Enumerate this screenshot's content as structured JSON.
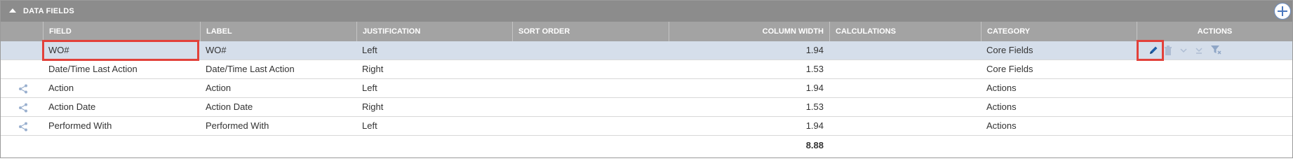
{
  "panel": {
    "title": "DATA FIELDS"
  },
  "columns": {
    "field": "FIELD",
    "label": "LABEL",
    "justification": "JUSTIFICATION",
    "sort_order": "SORT ORDER",
    "column_width": "COLUMN WIDTH",
    "calculations": "CALCULATIONS",
    "category": "CATEGORY",
    "actions": "ACTIONS"
  },
  "rows": [
    {
      "field": "WO#",
      "label": "WO#",
      "justification": "Left",
      "sort_order": "",
      "column_width": "1.94",
      "calculations": "",
      "category": "Core Fields"
    },
    {
      "field": "Date/Time Last Action",
      "label": "Date/Time Last Action",
      "justification": "Right",
      "sort_order": "",
      "column_width": "1.53",
      "calculations": "",
      "category": "Core Fields"
    },
    {
      "field": "Action",
      "label": "Action",
      "justification": "Left",
      "sort_order": "",
      "column_width": "1.94",
      "calculations": "",
      "category": "Actions"
    },
    {
      "field": "Action Date",
      "label": "Action Date",
      "justification": "Right",
      "sort_order": "",
      "column_width": "1.53",
      "calculations": "",
      "category": "Actions"
    },
    {
      "field": "Performed With",
      "label": "Performed With",
      "justification": "Left",
      "sort_order": "",
      "column_width": "1.94",
      "calculations": "",
      "category": "Actions"
    }
  ],
  "total_width": "8.88",
  "colors": {
    "header_bg": "#8c8c8c",
    "column_header_bg": "#a3a3a3",
    "selected_row_bg": "#d5deea",
    "highlight": "#e2413a",
    "icon_blue": "#1f5fa8"
  },
  "icons": {
    "collapse": "triangle-up-icon",
    "add": "plus-circle-icon",
    "row_handle": "share-icon",
    "actions": [
      "pencil-icon",
      "trash-icon",
      "chevron-down-icon",
      "move-to-bottom-icon",
      "filter-icon"
    ]
  }
}
